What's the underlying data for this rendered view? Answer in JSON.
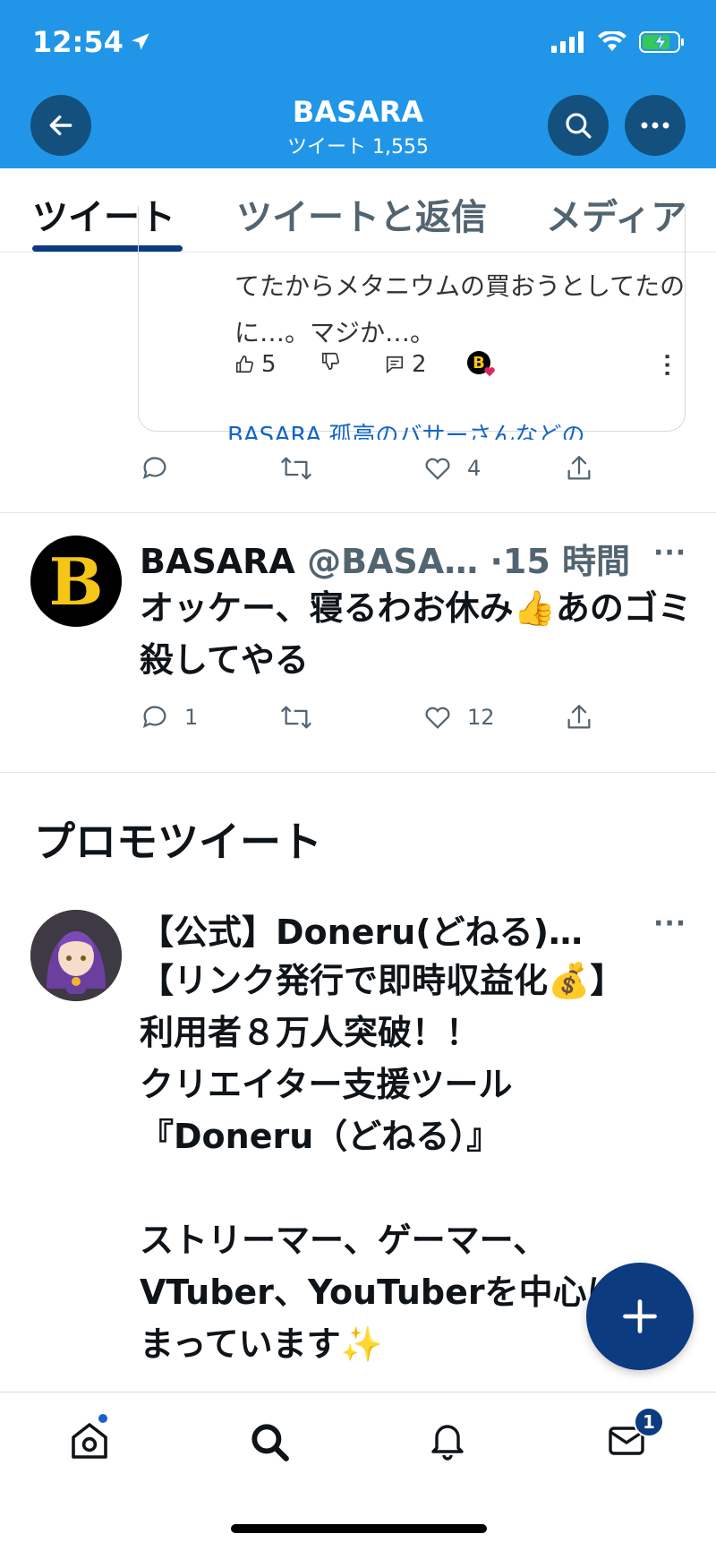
{
  "status": {
    "time": "12:54"
  },
  "header": {
    "title": "BASARA",
    "subtitle": "ツイート 1,555"
  },
  "tabs": [
    {
      "label": "ツイート",
      "active": true
    },
    {
      "label": "ツイートと返信",
      "active": false
    },
    {
      "label": "メディア",
      "active": false
    }
  ],
  "embedded_card": {
    "text": "てたからメタニウムの買おうとしてたのに…。マジか…。",
    "likes": "5",
    "replies": "2",
    "avatar_letter": "B",
    "link_text": "BASARA 孤高のバサーさんなどの"
  },
  "tweet0_actions": {
    "reply": "",
    "retweet": "",
    "like": "4"
  },
  "tweet1": {
    "avatar_letter": "B",
    "name": "BASARA",
    "handle": "@BASA…",
    "time": "·15 時間",
    "more": "···",
    "text": "オッケー、寝るわお休み👍あのゴミ殺してやる",
    "reply_count": "1",
    "like_count": "12"
  },
  "promo": {
    "heading": "プロモツイート",
    "name": "【公式】Doneru(どねる)…",
    "more": "···",
    "text": "【リンク発行で即時収益化💰】\n利用者８万人突破！！\nクリエイター支援ツール\n『Doneru（どねる）』\n\nストリーマー、ゲーマー、\nVTuber、YouTuberを中心に\nまっています✨"
  },
  "nav": {
    "messages_badge": "1"
  },
  "colors": {
    "header": "#2196e9",
    "accent": "#0c3b80",
    "link": "#1464c8"
  }
}
